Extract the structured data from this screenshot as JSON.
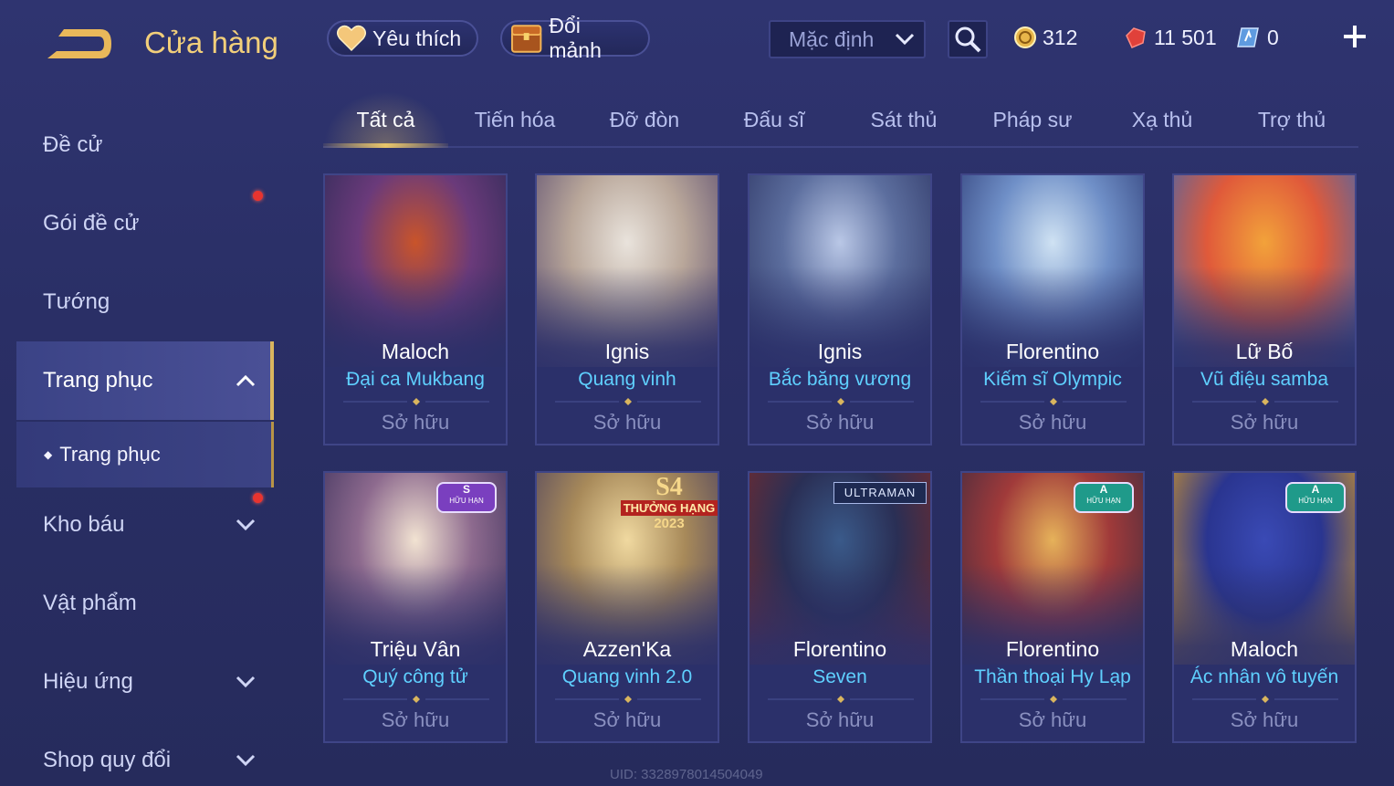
{
  "header": {
    "title": "Cửa hàng",
    "favorite_label": "Yêu thích",
    "exchange_label": "Đổi mảnh",
    "sort_value": "Mặc định",
    "currencies": {
      "gold": "312",
      "gems": "11 501",
      "vouchers": "0"
    }
  },
  "sidebar": {
    "items": [
      "Đề cử",
      "Gói đề cử",
      "Tướng",
      "Trang phục",
      "Kho báu",
      "Vật phẩm",
      "Hiệu ứng",
      "Shop quy đổi"
    ],
    "sub_item": "Trang phục"
  },
  "tabs": [
    "Tất cả",
    "Tiến hóa",
    "Đỡ đòn",
    "Đấu sĩ",
    "Sát thủ",
    "Pháp sư",
    "Xạ thủ",
    "Trợ thủ"
  ],
  "cards": [
    {
      "hero": "Maloch",
      "skin": "Đại ca Mukbang",
      "status": "Sở hữu",
      "art_colors": [
        "#c9542a",
        "#6a3a7a",
        "#2b2a55"
      ]
    },
    {
      "hero": "Ignis",
      "skin": "Quang vinh",
      "status": "Sở hữu",
      "art_colors": [
        "#e9e3dc",
        "#b9a79a",
        "#5a4b6e"
      ]
    },
    {
      "hero": "Ignis",
      "skin": "Bắc băng vương",
      "status": "Sở hữu",
      "art_colors": [
        "#b9c7e6",
        "#5c6e9e",
        "#2d3564"
      ]
    },
    {
      "hero": "Florentino",
      "skin": "Kiếm sĩ Olympic",
      "status": "Sở hữu",
      "art_colors": [
        "#cfe2f3",
        "#6f8fc7",
        "#2c3a74"
      ]
    },
    {
      "hero": "Lữ Bố",
      "skin": "Vũ điệu samba",
      "status": "Sở hữu",
      "art_colors": [
        "#f2a23a",
        "#e05a3a",
        "#3a67b3"
      ]
    },
    {
      "hero": "Triệu Vân",
      "skin": "Quý công tử",
      "status": "Sở hữu",
      "badge": "S",
      "badge_text": "HỮU HẠN",
      "art_colors": [
        "#f2e3d2",
        "#8d6a8e",
        "#3a2f5a"
      ]
    },
    {
      "hero": "Azzen'Ka",
      "skin": "Quang vinh 2.0",
      "status": "Sở hữu",
      "badge": "S4",
      "badge_text": "THƯỞNG HẠNG",
      "badge_year": "2023",
      "art_colors": [
        "#f0d9a0",
        "#a88a5a",
        "#4a3f5f"
      ]
    },
    {
      "hero": "Florentino",
      "skin": "Seven",
      "status": "Sở hữu",
      "badge_text": "ULTRAMAN",
      "art_colors": [
        "#3a5a8a",
        "#2a2f55",
        "#7a2a2a"
      ]
    },
    {
      "hero": "Florentino",
      "skin": "Thần thoại Hy Lạp",
      "status": "Sở hữu",
      "badge": "A",
      "badge_text": "HỮU HẠN",
      "art_colors": [
        "#e6b25a",
        "#a03a3a",
        "#3a2a3f"
      ]
    },
    {
      "hero": "Maloch",
      "skin": "Ác nhân vô tuyến",
      "status": "Sở hữu",
      "badge": "A",
      "badge_text": "HỮU HẠN",
      "art_colors": [
        "#3a4ab5",
        "#2a3590",
        "#e0a020"
      ]
    }
  ],
  "uid": "UID: 3328978014504049"
}
